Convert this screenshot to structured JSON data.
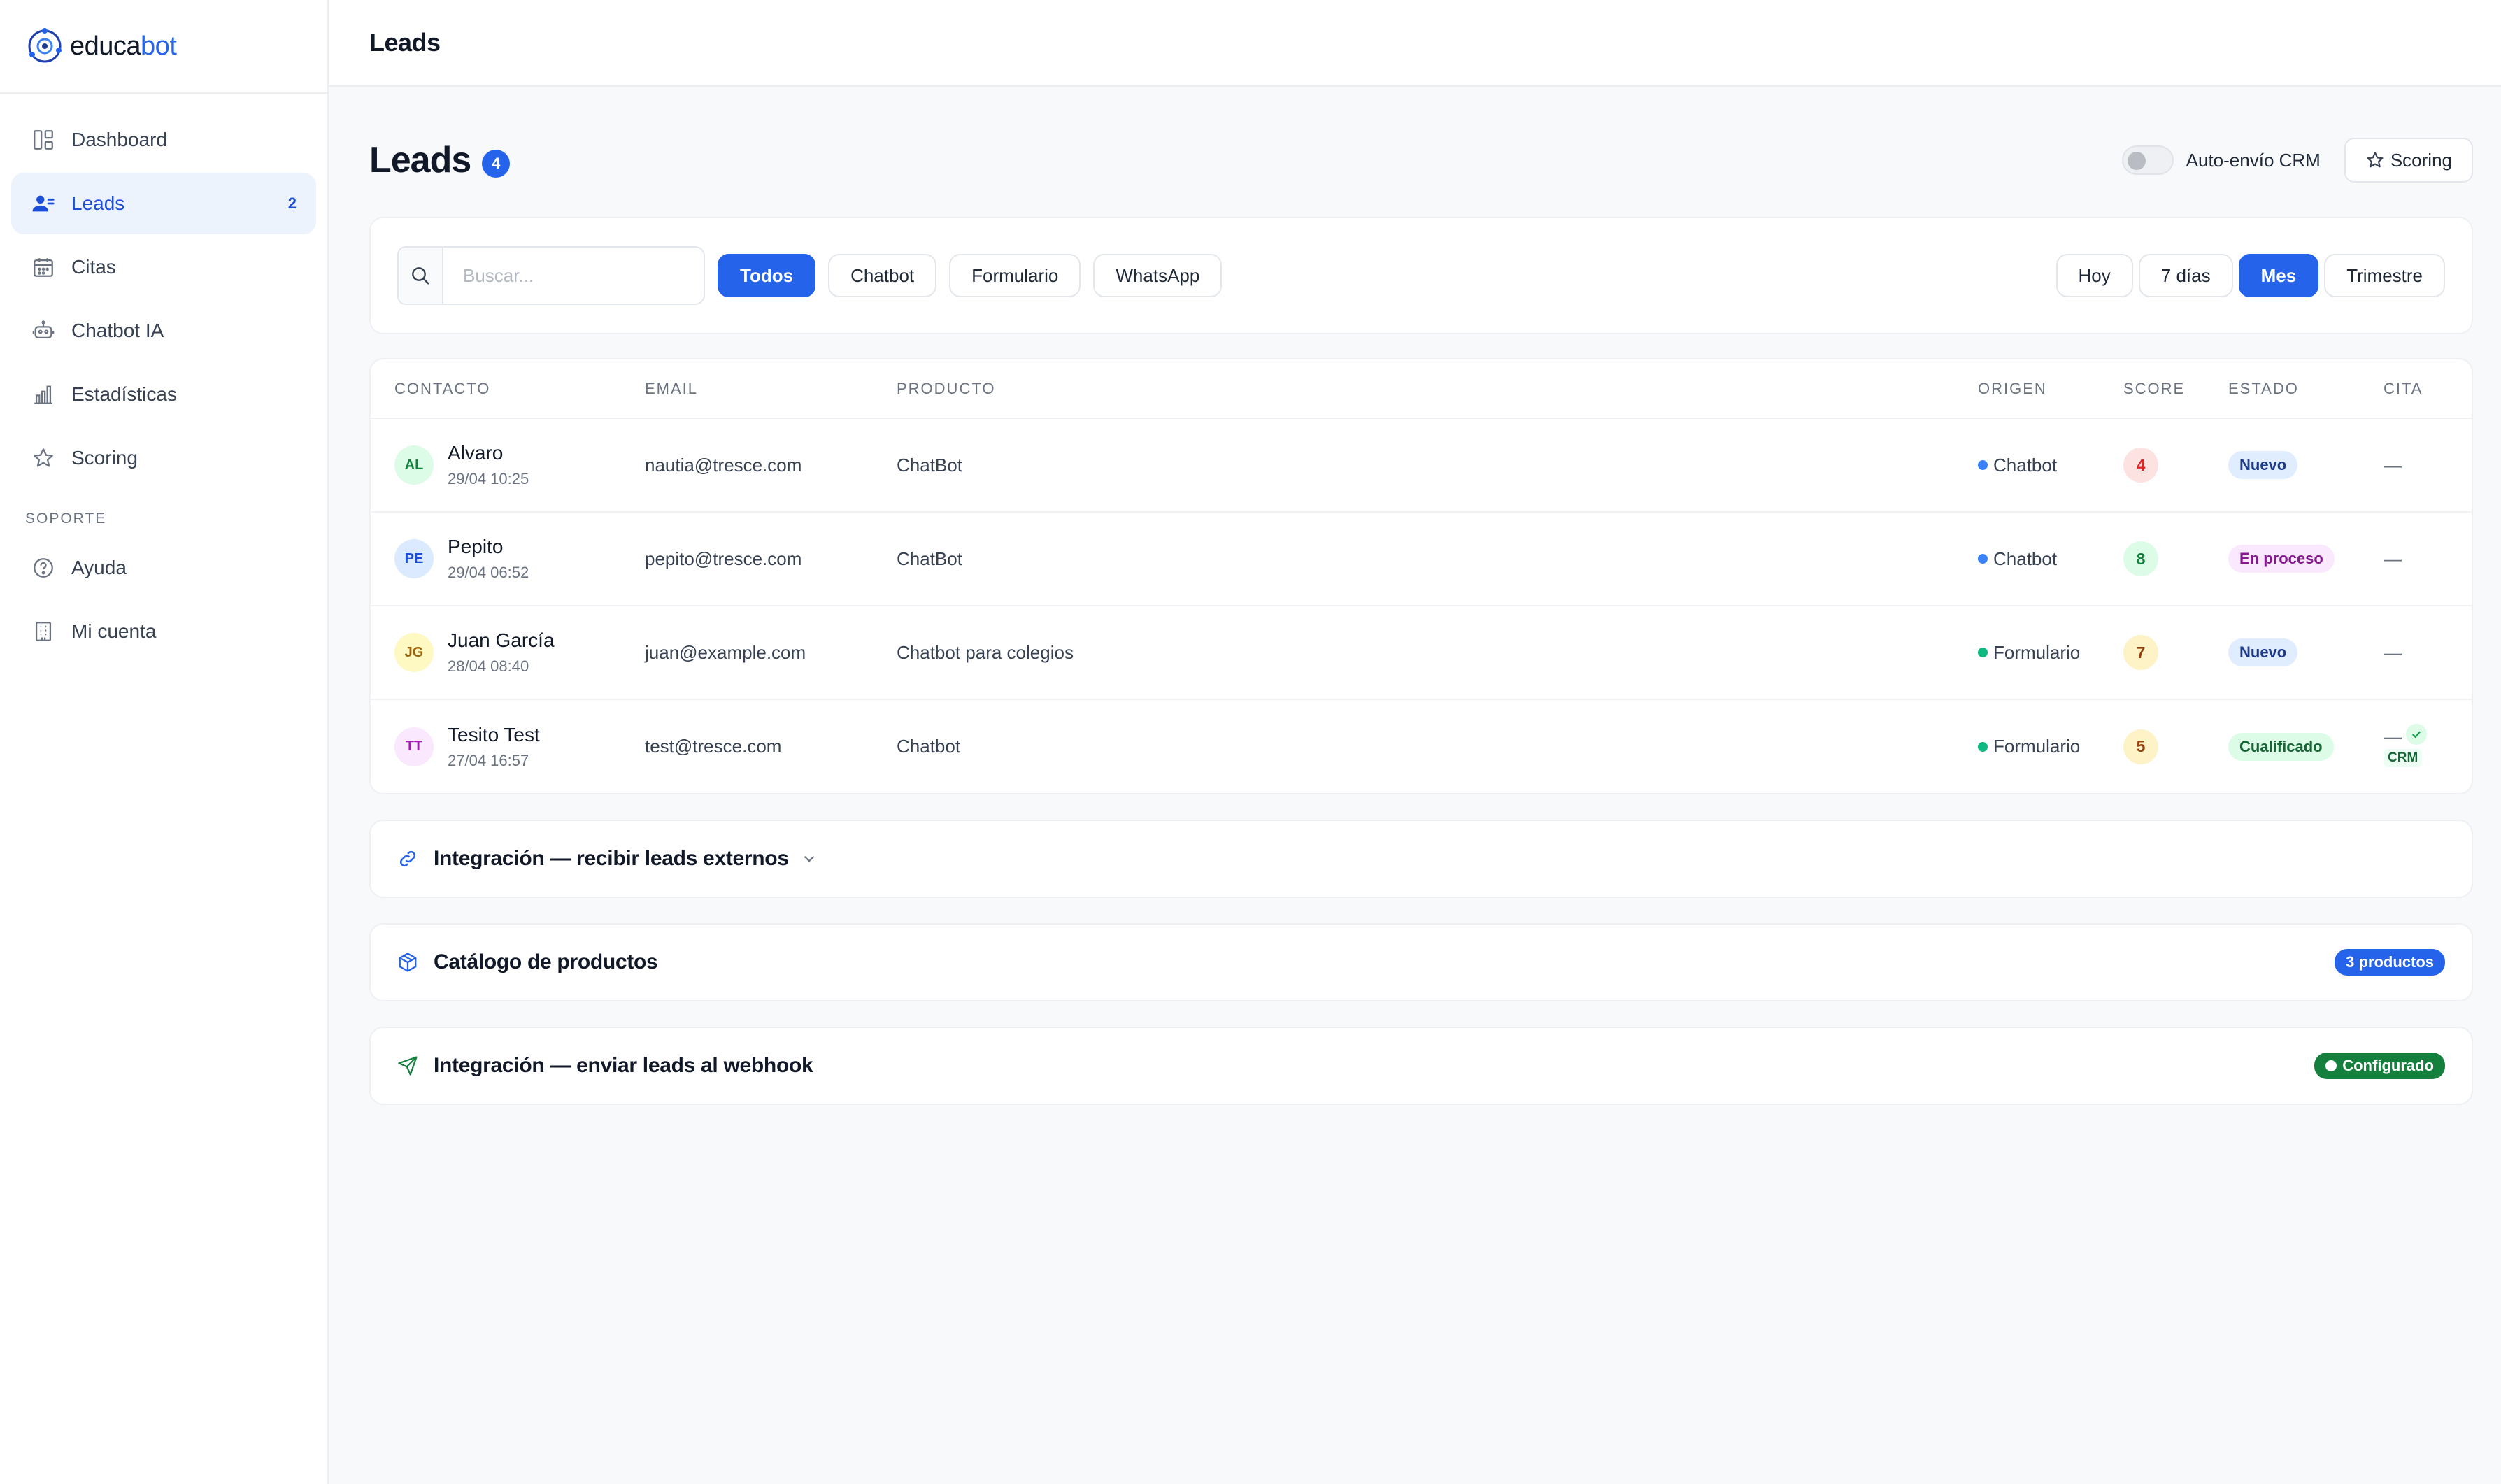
{
  "brand": {
    "name_part1": "educa",
    "name_part2": "bot"
  },
  "sidebar": {
    "items": [
      {
        "label": "Dashboard",
        "icon": "dashboard-icon",
        "active": false
      },
      {
        "label": "Leads",
        "icon": "users-icon",
        "active": true,
        "count": "2"
      },
      {
        "label": "Citas",
        "icon": "calendar-icon",
        "active": false
      },
      {
        "label": "Chatbot IA",
        "icon": "robot-icon",
        "active": false
      },
      {
        "label": "Estadísticas",
        "icon": "bar-chart-icon",
        "active": false
      },
      {
        "label": "Scoring",
        "icon": "star-icon",
        "active": false
      }
    ],
    "section_label": "SOPORTE",
    "support_items": [
      {
        "label": "Ayuda",
        "icon": "help-circle-icon"
      },
      {
        "label": "Mi cuenta",
        "icon": "building-icon"
      }
    ]
  },
  "topbar": {
    "title": "Leads"
  },
  "page": {
    "title": "Leads",
    "count": "4",
    "toggle_label": "Auto-envío CRM",
    "scoring_button": "Scoring"
  },
  "filters": {
    "search_placeholder": "Buscar...",
    "source_chips": [
      "Todos",
      "Chatbot",
      "Formulario",
      "WhatsApp"
    ],
    "source_selected": "Todos",
    "period_chips": [
      "Hoy",
      "7 días",
      "Mes",
      "Trimestre"
    ],
    "period_selected": "Mes"
  },
  "table": {
    "columns": [
      "CONTACTO",
      "EMAIL",
      "PRODUCTO",
      "ORIGEN",
      "SCORE",
      "ESTADO",
      "CITA"
    ],
    "rows": [
      {
        "initials": "AL",
        "name": "Alvaro",
        "date": "29/04 10:25",
        "email": "nautia@tresce.com",
        "product": "ChatBot",
        "origin": "Chatbot",
        "score": "4",
        "status": "Nuevo",
        "cita": "—"
      },
      {
        "initials": "PE",
        "name": "Pepito",
        "date": "29/04 06:52",
        "email": "pepito@tresce.com",
        "product": "ChatBot",
        "origin": "Chatbot",
        "score": "8",
        "status": "En proceso",
        "cita": "—"
      },
      {
        "initials": "JG",
        "name": "Juan García",
        "date": "28/04 08:40",
        "email": "juan@example.com",
        "product": "Chatbot para colegios",
        "origin": "Formulario",
        "score": "7",
        "status": "Nuevo",
        "cita": "—"
      },
      {
        "initials": "TT",
        "name": "Tesito Test",
        "date": "27/04 16:57",
        "email": "test@tresce.com",
        "product": "Chatbot",
        "origin": "Formulario",
        "score": "5",
        "status": "Cualificado",
        "cita": "—",
        "crm": "CRM"
      }
    ]
  },
  "sections": {
    "integration_in": "Integración — recibir leads externos",
    "catalog": "Catálogo de productos",
    "catalog_badge": "3 productos",
    "integration_out": "Integración — enviar leads al webhook",
    "integration_out_badge": "Configurado"
  },
  "colors": {
    "accent": "#2563eb",
    "chatbot_dot": "#3b82f6",
    "formulario_dot": "#10b981",
    "success": "#15803d"
  }
}
